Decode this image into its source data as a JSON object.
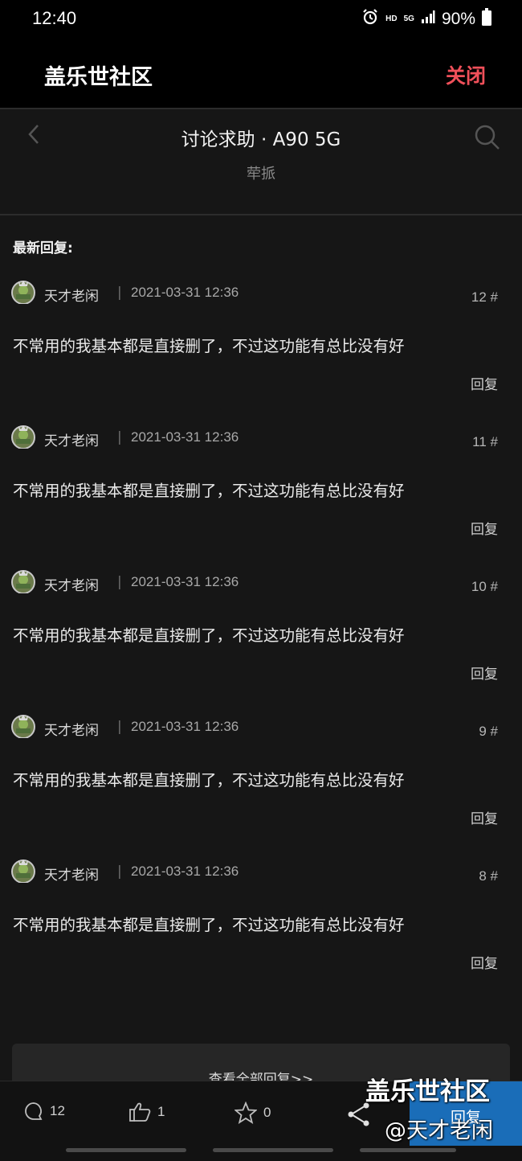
{
  "status_bar": {
    "time": "12:40",
    "hd": "HD",
    "network": "5G",
    "battery": "90%"
  },
  "header": {
    "title": "盖乐世社区",
    "close_label": "关闭",
    "close_color": "#f0505a"
  },
  "thread": {
    "board": "讨论求助 · A90 5G",
    "subtitle": "荦挀"
  },
  "section_label": "最新回复:",
  "replies": [
    {
      "author": "天才老闲",
      "separator": "|",
      "time": "2021-03-31 12:36",
      "floor": "12 #",
      "text": "不常用的我基本都是直接删了，不过这功能有总比没有好",
      "reply_label": "回复"
    },
    {
      "author": "天才老闲",
      "separator": "|",
      "time": "2021-03-31 12:36",
      "floor": "11 #",
      "text": "不常用的我基本都是直接删了，不过这功能有总比没有好",
      "reply_label": "回复"
    },
    {
      "author": "天才老闲",
      "separator": "|",
      "time": "2021-03-31 12:36",
      "floor": "10 #",
      "text": "不常用的我基本都是直接删了，不过这功能有总比没有好",
      "reply_label": "回复"
    },
    {
      "author": "天才老闲",
      "separator": "|",
      "time": "2021-03-31 12:36",
      "floor": "9 #",
      "text": "不常用的我基本都是直接删了，不过这功能有总比没有好",
      "reply_label": "回复"
    },
    {
      "author": "天才老闲",
      "separator": "|",
      "time": "2021-03-31 12:36",
      "floor": "8 #",
      "text": "不常用的我基本都是直接删了，不过这功能有总比没有好",
      "reply_label": "回复"
    }
  ],
  "view_all_label": "查看全部回复>>",
  "bottom_bar": {
    "comments_count": "12",
    "likes_count": "1",
    "favorites_count": "0",
    "reply_label": "回复",
    "reply_color": "#1a6db8"
  },
  "watermark": {
    "line1": "盖乐世社区",
    "line2": "@天才老闲"
  },
  "icons": [
    "back-icon",
    "search-icon",
    "comment-icon",
    "thumbs-up-icon",
    "star-icon",
    "share-icon",
    "alarm-icon",
    "signal-icon",
    "battery-icon"
  ]
}
